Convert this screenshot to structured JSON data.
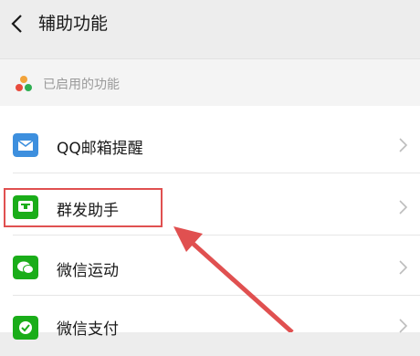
{
  "header": {
    "title": "辅助功能"
  },
  "section": {
    "label": "已启用的功能"
  },
  "items": [
    {
      "label": "QQ邮箱提醒",
      "icon": "mail-icon"
    },
    {
      "label": "群发助手",
      "icon": "group-message-icon"
    },
    {
      "label": "微信运动",
      "icon": "wechat-icon"
    },
    {
      "label": "微信支付",
      "icon": "wechat-pay-icon"
    }
  ],
  "colors": {
    "mail": "#3d8fde",
    "green": "#1aad19",
    "highlight": "#e05050"
  }
}
